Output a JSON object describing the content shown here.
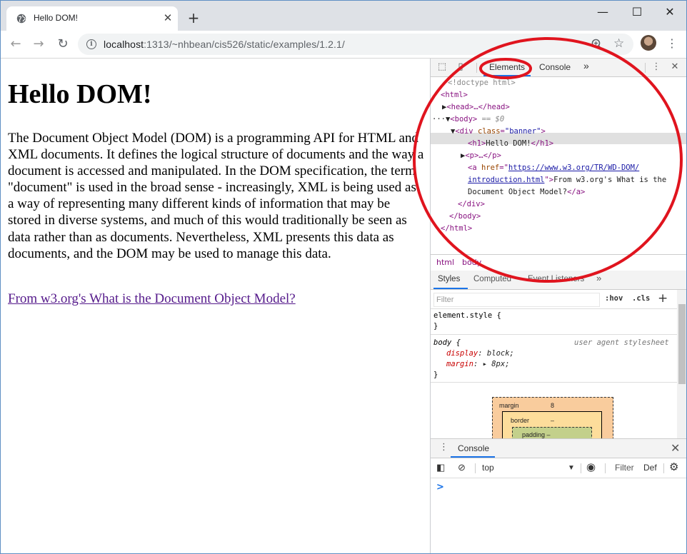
{
  "browser": {
    "tab_title": "Hello DOM!",
    "url_host": "localhost",
    "url_path": ":1313/~nhbean/cis526/static/examples/1.2.1/",
    "window_controls": [
      "minimize-icon",
      "maximize-icon",
      "close-icon"
    ]
  },
  "page": {
    "heading": "Hello DOM!",
    "paragraph": "The Document Object Model (DOM) is a programming API for HTML and XML documents. It defines the logical structure of documents and the way a document is accessed and manipulated. In the DOM specification, the term \"document\" is used in the broad sense - increasingly, XML is being used as a way of representing many different kinds of information that may be stored in diverse systems, and much of this would traditionally be seen as data rather than as documents. Nevertheless, XML presents this data as documents, and the DOM may be used to manage this data.",
    "link_text": "From w3.org's What is the Document Object Model?",
    "link_color": "#551a8b"
  },
  "devtools": {
    "tabs": {
      "elements": "Elements",
      "console": "Console",
      "more": "»"
    },
    "dom": {
      "doctype": "<!doctype html>",
      "html_open": "<html>",
      "head": "<head>…</head>",
      "body_open": "<body>",
      "body_marker": "== $0",
      "div_open_tag": "<div ",
      "div_attr": "class",
      "div_val": "\"banner\"",
      "h1_open": "<h1>",
      "h1_text": "Hello DOM!",
      "h1_close": "</h1>",
      "p_collapsed": "<p>…</p>",
      "a_open": "<a ",
      "a_attr": "href",
      "a_href_1": "https://www.w3.org/TR/WD-DOM/",
      "a_href_2": "introduction.html",
      "a_text_1": "From w3.org's What is the",
      "a_text_2": "Document Object Model?",
      "a_close": "</a>",
      "div_close": "</div>",
      "body_close": "</body>",
      "html_close": "</html>"
    },
    "breadcrumbs": [
      "html",
      "body"
    ],
    "sub_tabs": {
      "styles": "Styles",
      "computed": "Computed",
      "listeners": "Event Listeners",
      "more": "»"
    },
    "filter_placeholder": "Filter",
    "hov": ":hov",
    "cls": ".cls",
    "styles": {
      "element_style": "element.style {",
      "close_brace": "}",
      "body_selector": "body {",
      "ua_label": "user agent stylesheet",
      "prop1": "display",
      "val1": "block;",
      "prop2": "margin",
      "val2": "8px;"
    },
    "box_model": {
      "margin_label": "margin",
      "margin_value": "8",
      "border_label": "border",
      "border_value": "–",
      "padding_label": "padding –"
    },
    "drawer": {
      "tab": "Console",
      "context": "top",
      "filter": "Filter",
      "levels": "Def",
      "prompt": ">"
    }
  },
  "annotation_color": "#e0141e"
}
